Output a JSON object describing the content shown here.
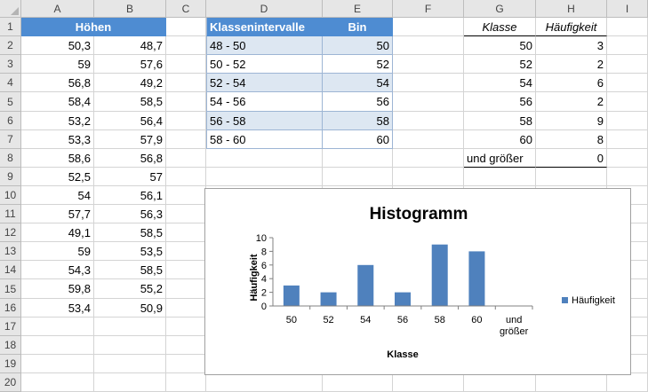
{
  "columns": [
    "A",
    "B",
    "C",
    "D",
    "E",
    "F",
    "G",
    "H",
    "I"
  ],
  "rows": [
    "1",
    "2",
    "3",
    "4",
    "5",
    "6",
    "7",
    "8",
    "9",
    "10",
    "11",
    "12",
    "13",
    "14",
    "15",
    "16",
    "17",
    "18",
    "19",
    "20"
  ],
  "hoehen": {
    "header": "Höhen",
    "col_a": [
      "50,3",
      "59",
      "56,8",
      "58,4",
      "53,2",
      "53,3",
      "58,6",
      "52,5",
      "54",
      "57,7",
      "49,1",
      "59",
      "54,3",
      "59,8",
      "53,4"
    ],
    "col_b": [
      "48,7",
      "57,6",
      "49,2",
      "58,5",
      "56,4",
      "57,9",
      "56,8",
      "57",
      "56,1",
      "56,3",
      "58,5",
      "53,5",
      "58,5",
      "55,2",
      "50,9"
    ]
  },
  "klassen_table": {
    "header_interval": "Klassenintervalle",
    "header_bin": "Bin",
    "intervals": [
      "48 - 50",
      "50 - 52",
      "52 - 54",
      "54 - 56",
      "56 - 58",
      "58 - 60"
    ],
    "bins": [
      "50",
      "52",
      "54",
      "56",
      "58",
      "60"
    ]
  },
  "freq_table": {
    "header_klasse": "Klasse",
    "header_haeufigkeit": "Häufigkeit",
    "klasse": [
      "50",
      "52",
      "54",
      "56",
      "58",
      "60",
      "und größer"
    ],
    "haeufigkeit": [
      "3",
      "2",
      "6",
      "2",
      "9",
      "8",
      "0"
    ]
  },
  "colors": {
    "header_blue": "#4e8cd2",
    "band": "#dde7f2",
    "bar": "#4f81bd"
  },
  "chart_data": {
    "type": "bar",
    "title": "Histogramm",
    "xlabel": "Klasse",
    "ylabel": "Häufigkeit",
    "categories": [
      "50",
      "52",
      "54",
      "56",
      "58",
      "60",
      "und größer"
    ],
    "series": [
      {
        "name": "Häufigkeit",
        "values": [
          3,
          2,
          6,
          2,
          9,
          8,
          0
        ]
      }
    ],
    "ylim": [
      0,
      10
    ],
    "yticks": [
      "0",
      "2",
      "4",
      "6",
      "8",
      "10"
    ],
    "legend": "right",
    "grid": false
  }
}
